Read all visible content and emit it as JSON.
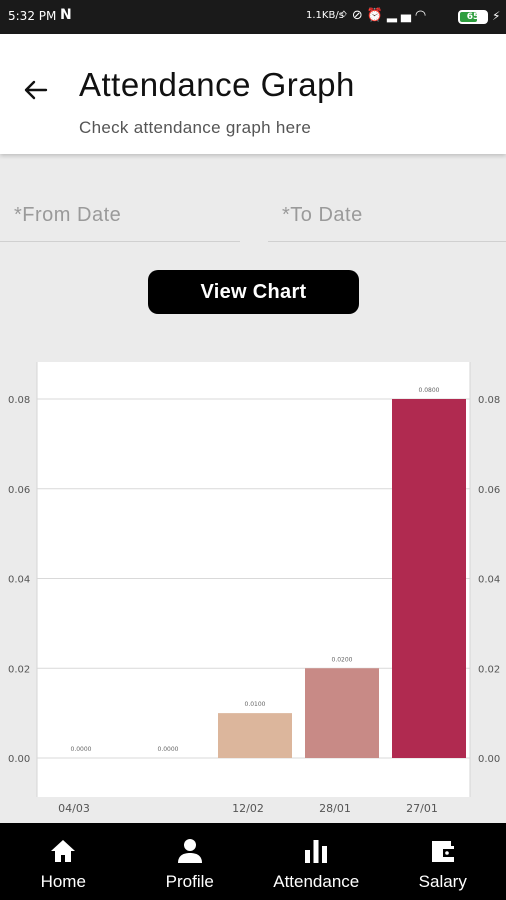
{
  "status_bar": {
    "time": "5:32 PM",
    "notification": "N",
    "network_speed": "1.1KB/s",
    "icons": [
      "bluetooth-icon",
      "no-signal-icon",
      "alarm-icon",
      "signal-icon",
      "wifi-icon"
    ],
    "battery_percent": "65",
    "battery_level": 0.65
  },
  "header": {
    "title": "Attendance Graph",
    "subtitle": "Check attendance graph here"
  },
  "form": {
    "from_date_placeholder": "*From Date",
    "to_date_placeholder": "*To Date",
    "view_chart_label": "View Chart"
  },
  "chart_data": {
    "type": "bar",
    "categories": [
      "04/03",
      "",
      "12/02",
      "28/01",
      "27/01"
    ],
    "values": [
      0.0,
      0.0,
      0.01,
      0.02,
      0.08
    ],
    "value_labels": [
      "0.0000",
      "0.0000",
      "0.0100",
      "0.0200",
      "0.0800"
    ],
    "bar_colors": [
      "#e8d2c4",
      "#e0c1ad",
      "#dcb69c",
      "#c88a86",
      "#b02a50"
    ],
    "y_ticks": [
      "0.00",
      "0.02",
      "0.04",
      "0.06",
      "0.08"
    ],
    "ylim": [
      0,
      0.088
    ],
    "grid": true
  },
  "bottom_nav": {
    "items": [
      {
        "label": "Home",
        "icon": "home-icon"
      },
      {
        "label": "Profile",
        "icon": "person-icon"
      },
      {
        "label": "Attendance",
        "icon": "bar-chart-icon"
      },
      {
        "label": "Salary",
        "icon": "wallet-icon"
      }
    ]
  }
}
